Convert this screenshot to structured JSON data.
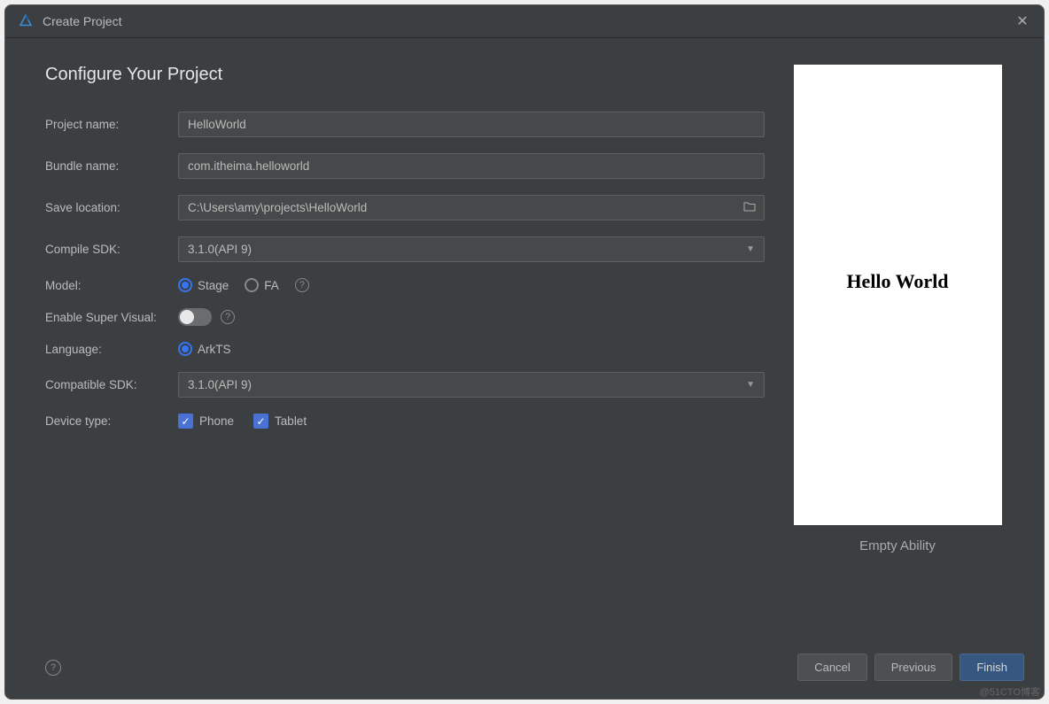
{
  "titleBar": {
    "title": "Create Project"
  },
  "heading": "Configure Your Project",
  "fields": {
    "projectName": {
      "label": "Project name:",
      "value": "HelloWorld"
    },
    "bundleName": {
      "label": "Bundle name:",
      "value": "com.itheima.helloworld"
    },
    "saveLocation": {
      "label": "Save location:",
      "value": "C:\\Users\\amy\\projects\\HelloWorld"
    },
    "compileSdk": {
      "label": "Compile SDK:",
      "value": "3.1.0(API 9)"
    },
    "model": {
      "label": "Model:",
      "option1": "Stage",
      "option2": "FA"
    },
    "superVisual": {
      "label": "Enable Super Visual:"
    },
    "language": {
      "label": "Language:",
      "option1": "ArkTS"
    },
    "compatibleSdk": {
      "label": "Compatible SDK:",
      "value": "3.1.0(API 9)"
    },
    "deviceType": {
      "label": "Device type:",
      "opt1": "Phone",
      "opt2": "Tablet"
    }
  },
  "preview": {
    "text": "Hello World",
    "label": "Empty Ability"
  },
  "footer": {
    "cancel": "Cancel",
    "previous": "Previous",
    "finish": "Finish"
  },
  "watermark": "@51CTO博客"
}
